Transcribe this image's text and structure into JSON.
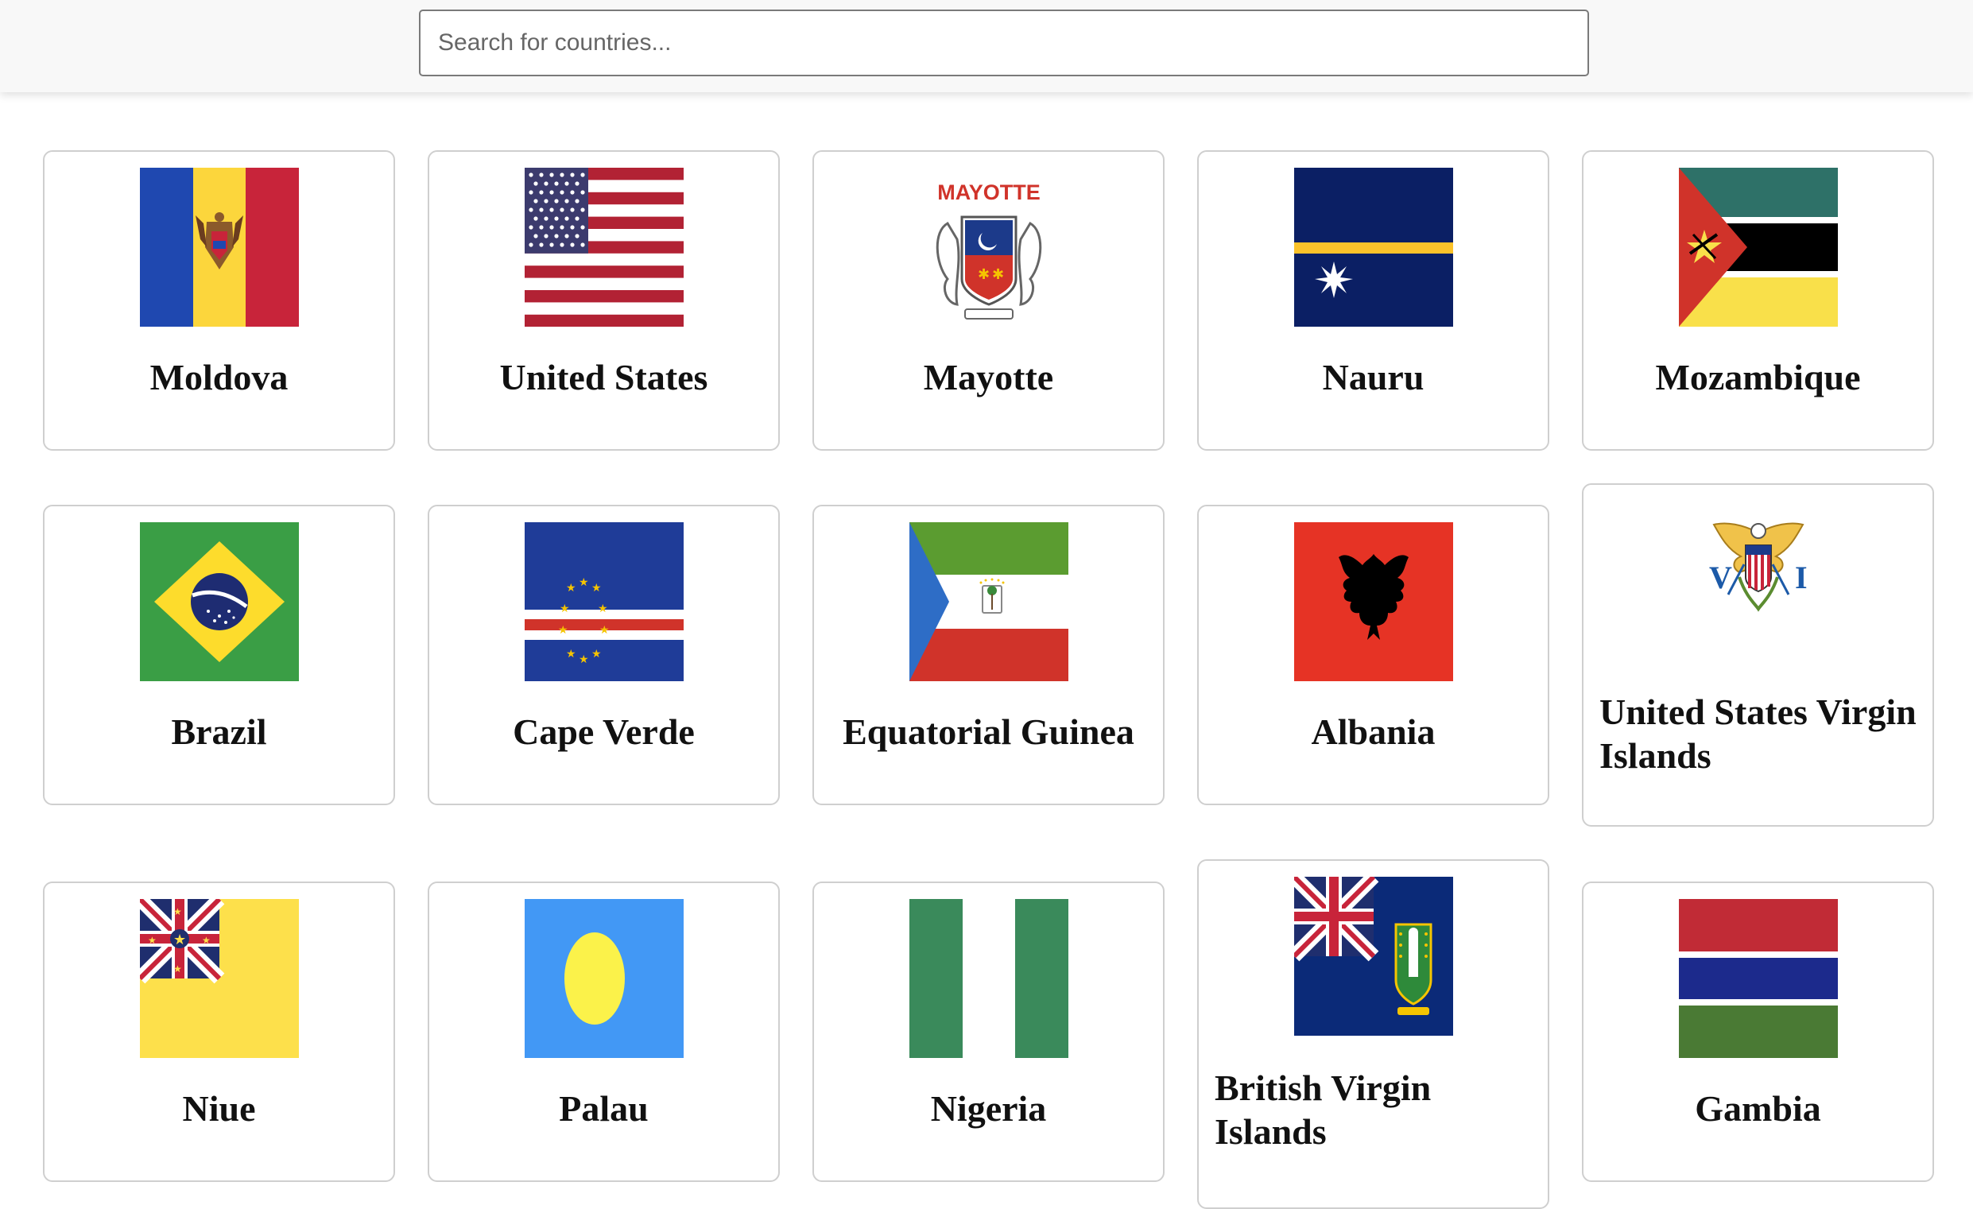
{
  "search": {
    "placeholder": "Search for countries..."
  },
  "countries": [
    {
      "name": "Moldova",
      "flag": "moldova-flag"
    },
    {
      "name": "United States",
      "flag": "united-states-flag"
    },
    {
      "name": "Mayotte",
      "flag": "mayotte-flag",
      "flag_text": "MAYOTTE"
    },
    {
      "name": "Nauru",
      "flag": "nauru-flag"
    },
    {
      "name": "Mozambique",
      "flag": "mozambique-flag"
    },
    {
      "name": "Brazil",
      "flag": "brazil-flag"
    },
    {
      "name": "Cape Verde",
      "flag": "cape-verde-flag"
    },
    {
      "name": "Equatorial Guinea",
      "flag": "equatorial-guinea-flag"
    },
    {
      "name": "Albania",
      "flag": "albania-flag"
    },
    {
      "name": "United States Virgin Islands",
      "flag": "us-virgin-islands-flag"
    },
    {
      "name": "Niue",
      "flag": "niue-flag"
    },
    {
      "name": "Palau",
      "flag": "palau-flag"
    },
    {
      "name": "Nigeria",
      "flag": "nigeria-flag"
    },
    {
      "name": "British Virgin Islands",
      "flag": "british-virgin-islands-flag"
    },
    {
      "name": "Gambia",
      "flag": "gambia-flag"
    }
  ]
}
